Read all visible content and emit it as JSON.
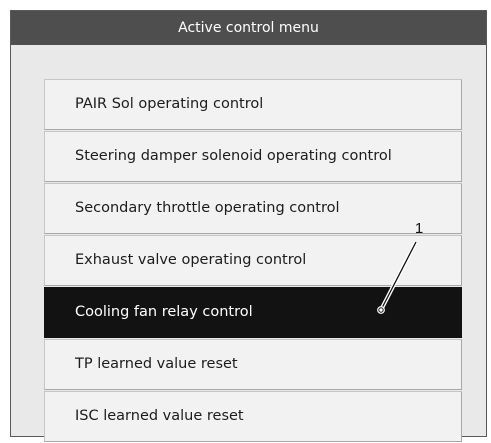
{
  "window": {
    "title": "Active control menu"
  },
  "menu": {
    "items": [
      {
        "label": "PAIR Sol operating control"
      },
      {
        "label": "Steering damper solenoid operating control"
      },
      {
        "label": "Secondary throttle operating control"
      },
      {
        "label": "Exhaust valve operating control"
      },
      {
        "label": "Cooling fan relay control",
        "selected": true
      },
      {
        "label": "TP learned value reset"
      },
      {
        "label": "ISC learned value reset"
      }
    ]
  },
  "callout": {
    "label": "1"
  },
  "colors": {
    "titlebar": "#4e4e4e",
    "background": "#e9e9e9",
    "item": "#f2f2f2",
    "selected": "#121212"
  }
}
